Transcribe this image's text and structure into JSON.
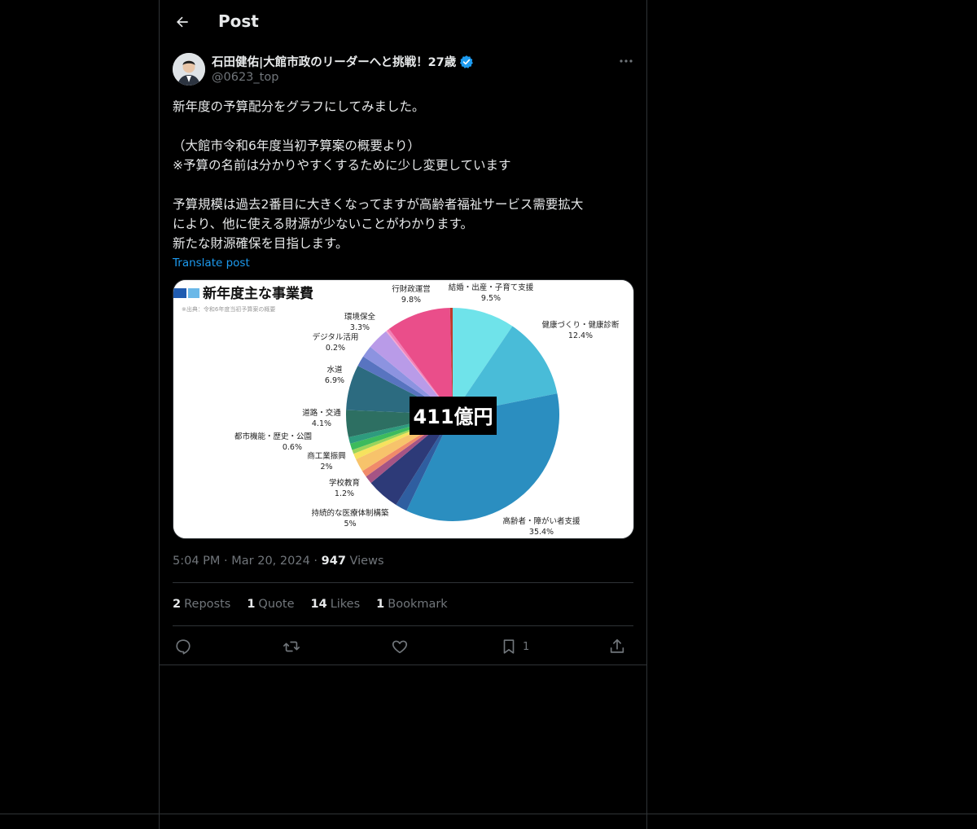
{
  "header": {
    "title": "Post"
  },
  "author": {
    "name": "石田健佑|大館市政のリーダーへと挑戦！27歳",
    "handle": "@0623_top"
  },
  "post": {
    "lines": [
      "新年度の予算配分をグラフにしてみました。",
      "",
      "（大館市令和6年度当初予算案の概要より）",
      "※予算の名前は分かりやすくするために少し変更しています",
      "",
      "予算規模は過去2番目に大きくなってますが高齢者福祉サービス需要拡大",
      "により、他に使える財源が少ないことがわかります。",
      "新たな財源確保を目指します。"
    ],
    "translate_label": "Translate post"
  },
  "chart_data": {
    "type": "pie",
    "title": "新年度主な事業費",
    "subtitle": "※出典：令和6年度当初予算案の概要",
    "center_label": "411億円",
    "slices": [
      {
        "label": "結婚・出産・子育て支援",
        "value": 9.5,
        "value_label": "9.5%",
        "color": "#6fe3ea"
      },
      {
        "label": "健康づくり・健康診断",
        "value": 12.4,
        "value_label": "12.4%",
        "color": "#49bcd8"
      },
      {
        "label": "高齢者・障がい者支援",
        "value": 35.4,
        "value_label": "35.4%",
        "color": "#2b8ec0"
      },
      {
        "label": "",
        "value": 1.8,
        "value_label": "",
        "color": "#2f5ea0"
      },
      {
        "label": "持続的な医療体制構築",
        "value": 5.0,
        "value_label": "5%",
        "color": "#2d3a78"
      },
      {
        "label": "学校教育",
        "value": 1.2,
        "value_label": "1.2%",
        "color": "#a55485"
      },
      {
        "label": "",
        "value": 1.0,
        "value_label": "",
        "color": "#f08a6a"
      },
      {
        "label": "商工業振興",
        "value": 2.0,
        "value_label": "2%",
        "color": "#f7c36b"
      },
      {
        "label": "",
        "value": 0.9,
        "value_label": "",
        "color": "#f6e25e"
      },
      {
        "label": "都市機能・歴史・公園",
        "value": 0.6,
        "value_label": "0.6%",
        "color": "#9ad45b"
      },
      {
        "label": "",
        "value": 1.0,
        "value_label": "",
        "color": "#3dbb5d"
      },
      {
        "label": "",
        "value": 1.0,
        "value_label": "",
        "color": "#2e9b7e"
      },
      {
        "label": "道路・交通",
        "value": 4.1,
        "value_label": "4.1%",
        "color": "#2d6f62"
      },
      {
        "label": "水道",
        "value": 6.9,
        "value_label": "6.9%",
        "color": "#2c6b80"
      },
      {
        "label": "",
        "value": 1.6,
        "value_label": "",
        "color": "#5874c0"
      },
      {
        "label": "",
        "value": 1.8,
        "value_label": "",
        "color": "#8c93e0"
      },
      {
        "label": "環境保全",
        "value": 3.3,
        "value_label": "3.3%",
        "color": "#b99be8"
      },
      {
        "label": "デジタル活用",
        "value": 0.2,
        "value_label": "0.2%",
        "color": "#f3a6d2"
      },
      {
        "label": "",
        "value": 0.4,
        "value_label": "",
        "color": "#f27fb6"
      },
      {
        "label": "行財政運営",
        "value": 9.8,
        "value_label": "9.8%",
        "color": "#ea4e8a"
      },
      {
        "label": "",
        "value": 0.4,
        "value_label": "",
        "color": "#c0392b"
      }
    ]
  },
  "meta": {
    "time": "5:04 PM",
    "date": "Mar 20, 2024",
    "views_count": "947",
    "views_label": "Views"
  },
  "stats": {
    "reposts_count": "2",
    "reposts_label": "Reposts",
    "quotes_count": "1",
    "quotes_label": "Quote",
    "likes_count": "14",
    "likes_label": "Likes",
    "bookmarks_count": "1",
    "bookmarks_label": "Bookmark"
  },
  "actions": {
    "bookmark_count": "1"
  },
  "colors": {
    "accent": "#1d9bf0",
    "text": "#e7e9ea",
    "muted": "#71767b",
    "border": "#2f3336",
    "background": "#000000"
  }
}
